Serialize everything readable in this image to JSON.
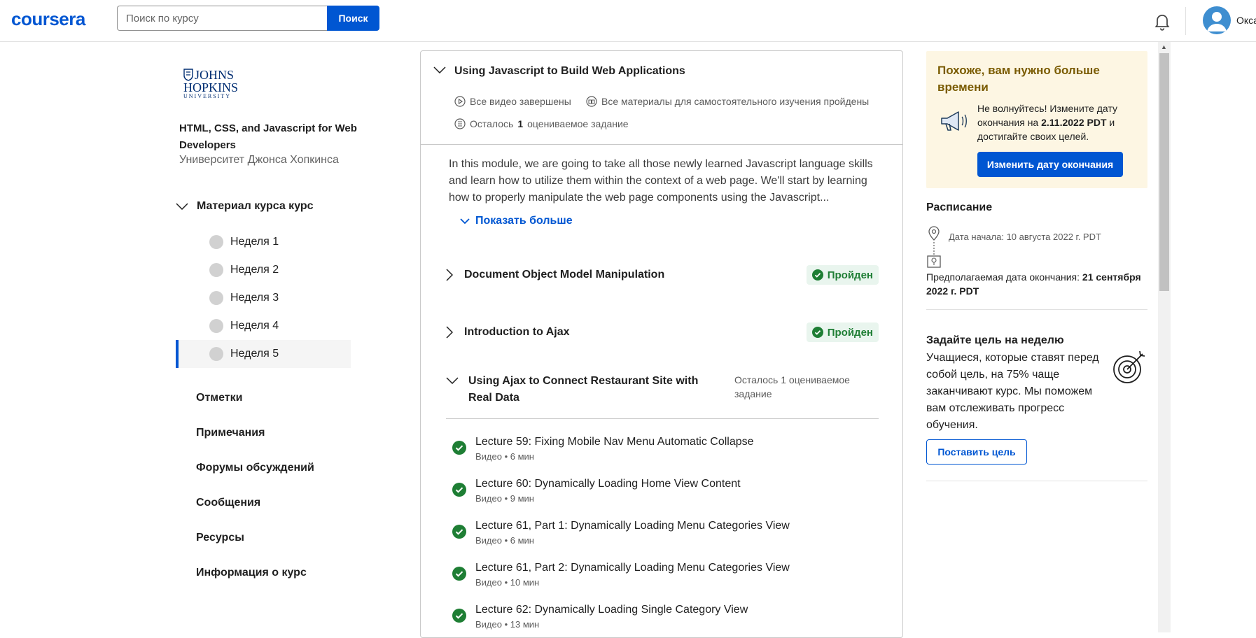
{
  "header": {
    "logo": "coursera",
    "search_placeholder": "Поиск по курсу",
    "search_button": "Поиск",
    "username": "Окса"
  },
  "sidebar": {
    "university_logo_lines": [
      "JOHNS",
      "HOPKINS",
      "UNIVERSITY"
    ],
    "course_title": "HTML, CSS, and Javascript for Web Developers",
    "university": "Университет Джонса Хопкинса",
    "material_heading": "Материал курса курс",
    "weeks": [
      {
        "label": "Неделя 1"
      },
      {
        "label": "Неделя 2"
      },
      {
        "label": "Неделя 3"
      },
      {
        "label": "Неделя 4"
      },
      {
        "label": "Неделя 5",
        "active": true
      }
    ],
    "nav": [
      "Отметки",
      "Примечания",
      "Форумы обсуждений",
      "Сообщения",
      "Ресурсы",
      "Информация о курс"
    ]
  },
  "module": {
    "title": "Using Javascript to Build Web Applications",
    "videos_status": "Все видео завершены",
    "readings_status": "Все материалы для самостоятельного изучения пройдены",
    "graded_prefix": "Осталось",
    "graded_count": "1",
    "graded_suffix": "оцениваемое задание",
    "description": "In this module, we are going to take all those newly learned Javascript language skills and learn how to utilize them within the context of a web page. We'll start by learning how to properly manipulate the web page components using the Javascript...",
    "show_more": "Показать больше",
    "lessons": [
      {
        "title": "Document Object Model Manipulation",
        "status": "Пройден"
      },
      {
        "title": "Introduction to Ajax",
        "status": "Пройден"
      }
    ],
    "open_lesson": {
      "title": "Using Ajax to Connect Restaurant Site with Real Data",
      "remaining": "Осталось 1 оцениваемое задание",
      "items": [
        {
          "title": "Lecture 59: Fixing Mobile Nav Menu Automatic Collapse",
          "meta": "Видео • 6 мин"
        },
        {
          "title": "Lecture 60: Dynamically Loading Home View Content",
          "meta": "Видео • 9 мин"
        },
        {
          "title": "Lecture 61, Part 1: Dynamically Loading Menu Categories View",
          "meta": "Видео • 6 мин"
        },
        {
          "title": "Lecture 61, Part 2: Dynamically Loading Menu Categories View",
          "meta": "Видео • 10 мин"
        },
        {
          "title": "Lecture 62: Dynamically Loading Single Category View",
          "meta": "Видео • 13 мин"
        }
      ]
    }
  },
  "right": {
    "deadline_card": {
      "title": "Похоже, вам нужно больше времени",
      "text_before": "Не волнуйтесь! Измените дату окончания на",
      "date": "2.11.2022 PDT",
      "text_after": "и достигайте своих целей.",
      "button": "Изменить дату окончания"
    },
    "schedule": {
      "title": "Расписание",
      "start": "Дата начала: 10 августа 2022 г. PDT",
      "end_label": "Предполагаемая дата окончания:",
      "end_date": "21 сентября 2022 г. PDT"
    },
    "goal": {
      "title": "Задайте цель на неделю",
      "text": "Учащиеся, которые ставят перед собой цель, на 75% чаще заканчивают курс. Мы поможем вам отслеживать прогресс обучения.",
      "button": "Поставить цель"
    }
  },
  "colors": {
    "brand": "#0056d2",
    "passed_bg": "#e9f5ee",
    "passed_fg": "#1e7e34",
    "card_bg": "#fdf6e3"
  }
}
